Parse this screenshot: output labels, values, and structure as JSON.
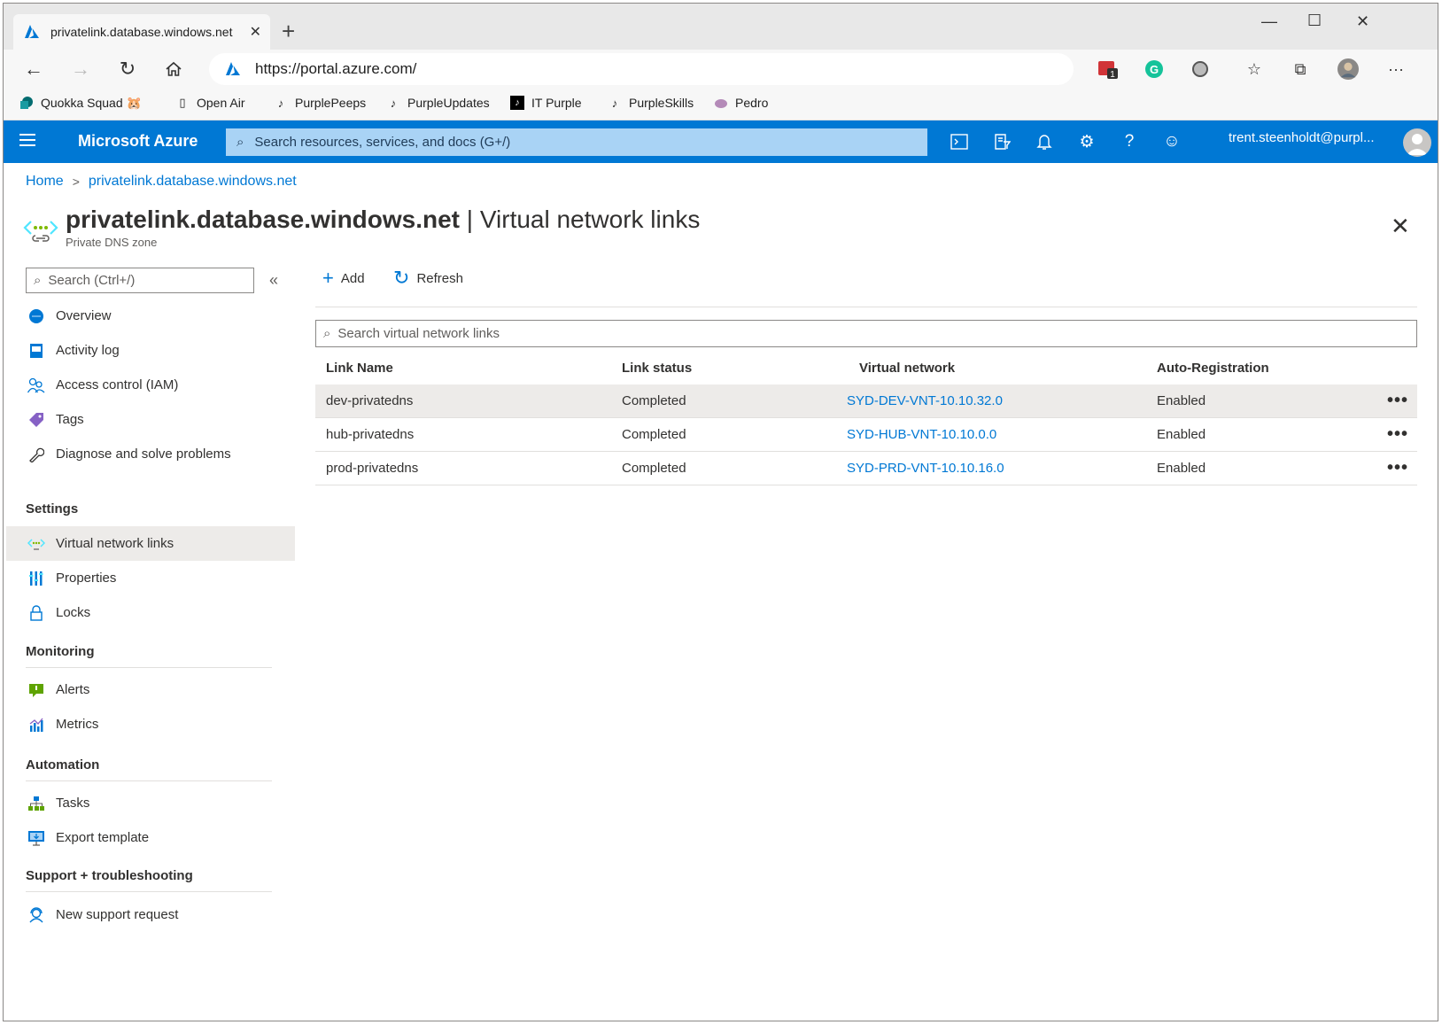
{
  "browser": {
    "tab_title": "privatelink.database.windows.net",
    "url": "https://portal.azure.com/",
    "bookmarks": [
      {
        "label": "Quokka Squad 🐹"
      },
      {
        "label": "Open Air"
      },
      {
        "label": "PurplePeeps"
      },
      {
        "label": "PurpleUpdates"
      },
      {
        "label": "IT Purple"
      },
      {
        "label": "PurpleSkills"
      },
      {
        "label": "Pedro"
      }
    ],
    "extension_badge": "1"
  },
  "azure": {
    "brand": "Microsoft Azure",
    "search_placeholder": "Search resources, services, and docs (G+/)",
    "user": "trent.steenholdt@purpl..."
  },
  "breadcrumb": {
    "home": "Home",
    "current": "privatelink.database.windows.net"
  },
  "page": {
    "title_resource": "privatelink.database.windows.net",
    "title_section": " | Virtual network links",
    "subtitle": "Private DNS zone"
  },
  "sidebar": {
    "search_placeholder": "Search (Ctrl+/)",
    "items_top": [
      {
        "label": "Overview"
      },
      {
        "label": "Activity log"
      },
      {
        "label": "Access control (IAM)"
      },
      {
        "label": "Tags"
      },
      {
        "label": "Diagnose and solve problems"
      }
    ],
    "sections": [
      {
        "header": "Settings",
        "items": [
          {
            "label": "Virtual network links"
          },
          {
            "label": "Properties"
          },
          {
            "label": "Locks"
          }
        ]
      },
      {
        "header": "Monitoring",
        "items": [
          {
            "label": "Alerts"
          },
          {
            "label": "Metrics"
          }
        ]
      },
      {
        "header": "Automation",
        "items": [
          {
            "label": "Tasks"
          },
          {
            "label": "Export template"
          }
        ]
      },
      {
        "header": "Support + troubleshooting",
        "items": [
          {
            "label": "New support request"
          }
        ]
      }
    ]
  },
  "toolbar": {
    "add": "Add",
    "refresh": "Refresh"
  },
  "filter_placeholder": "Search virtual network links",
  "table": {
    "columns": [
      "Link Name",
      "Link status",
      "Virtual network",
      "Auto-Registration"
    ],
    "rows": [
      {
        "name": "dev-privatedns",
        "status": "Completed",
        "vnet": "SYD-DEV-VNT-10.10.32.0",
        "auto": "Enabled"
      },
      {
        "name": "hub-privatedns",
        "status": "Completed",
        "vnet": "SYD-HUB-VNT-10.10.0.0",
        "auto": "Enabled"
      },
      {
        "name": "prod-privatedns",
        "status": "Completed",
        "vnet": "SYD-PRD-VNT-10.10.16.0",
        "auto": "Enabled"
      }
    ],
    "more_label": "•••"
  },
  "colors": {
    "azure_blue": "#0078d4",
    "selected_bg": "#edebe9"
  }
}
